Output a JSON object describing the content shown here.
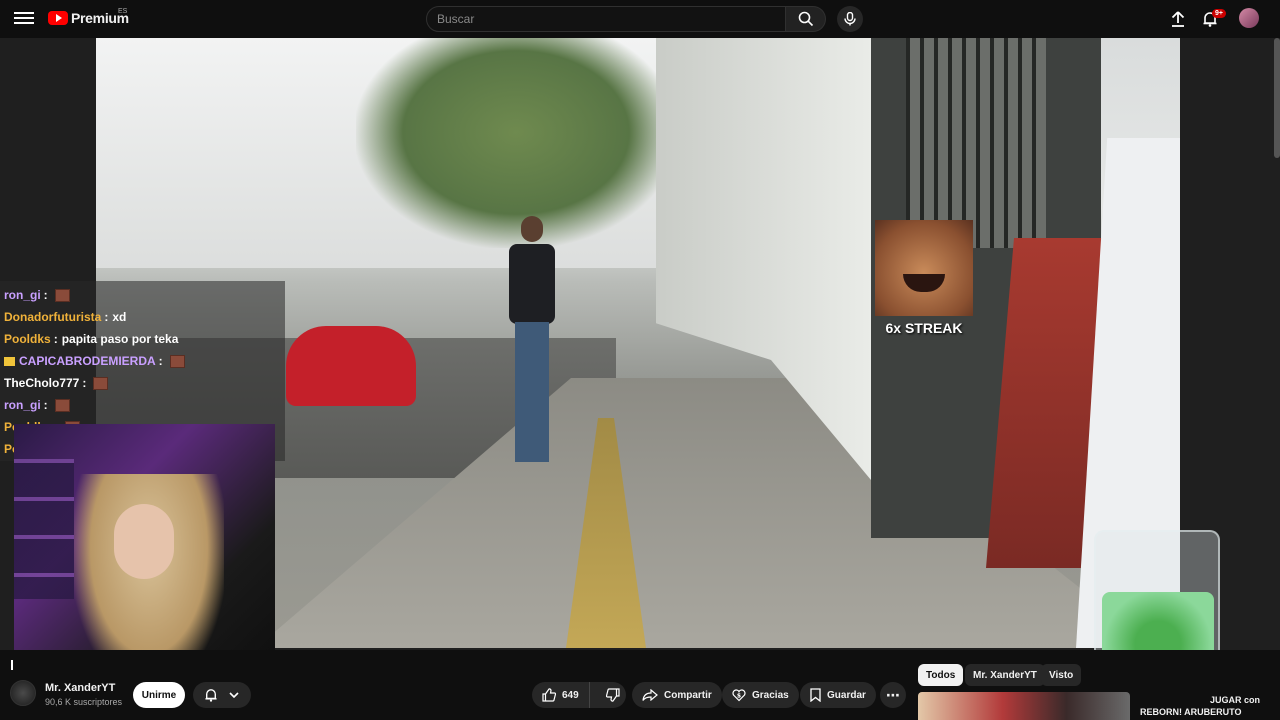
{
  "header": {
    "logo_text": "Premium",
    "logo_region": "ES",
    "search_placeholder": "Buscar",
    "notification_count": "9+"
  },
  "video": {
    "streak_text": "6x STREAK"
  },
  "chat": [
    {
      "user": "ron_gi",
      "user_color": "#c9a0ff",
      "message": "",
      "emote": true,
      "badge": false
    },
    {
      "user": "Donadorfuturista",
      "user_color": "#f0b23a",
      "message": "xd",
      "emote": false,
      "badge": false
    },
    {
      "user": "Pooldks",
      "user_color": "#f0b23a",
      "message": "papita paso por teka",
      "emote": false,
      "badge": false
    },
    {
      "user": "CAPICABRODEMIERDA",
      "user_color": "#c9a0ff",
      "message": "",
      "emote": true,
      "badge": true
    },
    {
      "user": "TheCholo777",
      "user_color": "#ffffff",
      "message": "",
      "emote": true,
      "badge": false
    },
    {
      "user": "ron_gi",
      "user_color": "#c9a0ff",
      "message": "",
      "emote": true,
      "badge": false
    },
    {
      "user": "Pooldks",
      "user_color": "#f0b23a",
      "message": "",
      "emote": true,
      "badge": false
    },
    {
      "user": "Pooldks",
      "user_color": "#f0b23a",
      "message": "",
      "emote": true,
      "badge": false
    }
  ],
  "channel": {
    "name": "Mr. XanderYT",
    "subscribers": "90,6 K suscriptores",
    "join_label": "Unirme"
  },
  "actions": {
    "like_count": "649",
    "share_label": "Compartir",
    "thanks_label": "Gracias",
    "save_label": "Guardar"
  },
  "chips": [
    "Todos",
    "Mr. XanderYT",
    "Visto"
  ],
  "recommendation": {
    "title_line1": "JUGAR con",
    "title_line2": "REBORN! ARUBERUTO"
  }
}
